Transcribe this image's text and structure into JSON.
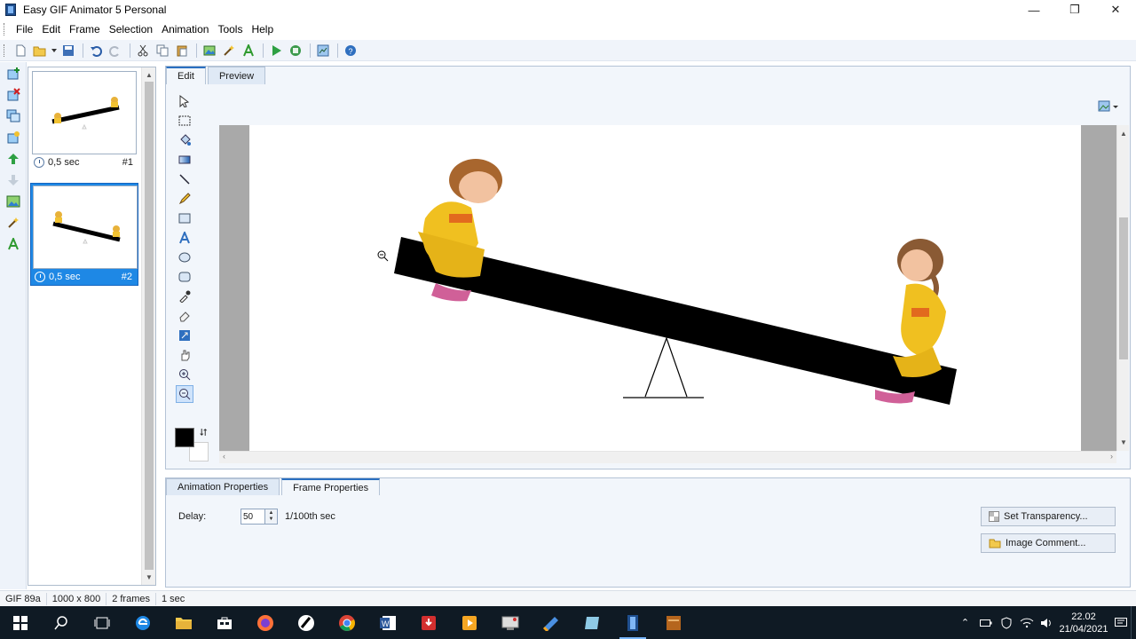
{
  "window": {
    "title": "Easy GIF Animator 5 Personal",
    "controls": [
      "—",
      "❐",
      "✕"
    ]
  },
  "menu": [
    "File",
    "Edit",
    "Frame",
    "Selection",
    "Animation",
    "Tools",
    "Help"
  ],
  "frames": [
    {
      "duration": "0,5 sec",
      "index": "#1",
      "selected": false
    },
    {
      "duration": "0,5 sec",
      "index": "#2",
      "selected": true
    }
  ],
  "editor": {
    "tabs": [
      "Edit",
      "Preview"
    ],
    "active_tab": "Edit"
  },
  "properties": {
    "tabs": [
      "Animation Properties",
      "Frame Properties"
    ],
    "active_tab": "Frame Properties",
    "delay_label": "Delay:",
    "delay_value": "50",
    "delay_unit": "1/100th sec",
    "set_transparency": "Set Transparency...",
    "image_comment": "Image Comment..."
  },
  "status": [
    "GIF 89a",
    "1000 x 800",
    "2 frames",
    "1 sec"
  ],
  "taskbar": {
    "time": "22.02",
    "date": "21/04/2021"
  },
  "colors": {
    "accent": "#1e88e5",
    "taskbar": "#0f1a24",
    "panel": "#f2f6fb"
  }
}
